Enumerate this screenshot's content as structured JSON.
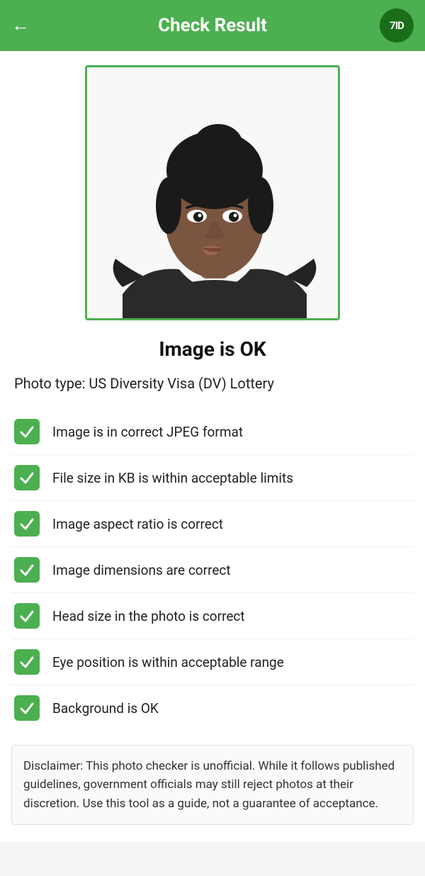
{
  "header": {
    "title": "Check Result",
    "back_arrow": "←",
    "logo_text": "7ID"
  },
  "photo": {
    "alt": "Passport photo of a young woman"
  },
  "status": {
    "heading": "Image is OK"
  },
  "photo_type_label": "Photo type: US Diversity Visa (DV) Lottery",
  "checks": [
    {
      "id": "jpeg",
      "label": "Image is in correct JPEG format",
      "passed": true
    },
    {
      "id": "filesize",
      "label": "File size in KB is within acceptable limits",
      "passed": true
    },
    {
      "id": "aspect",
      "label": "Image aspect ratio is correct",
      "passed": true
    },
    {
      "id": "dimensions",
      "label": "Image dimensions are correct",
      "passed": true
    },
    {
      "id": "headsize",
      "label": "Head size in the photo is correct",
      "passed": true
    },
    {
      "id": "eyepos",
      "label": "Eye position is within acceptable range",
      "passed": true
    },
    {
      "id": "background",
      "label": "Background is OK",
      "passed": true
    }
  ],
  "disclaimer": {
    "text": "Disclaimer: This photo checker is unofficial. While it follows published guidelines, government officials may still reject photos at their discretion. Use this tool as a guide, not a guarantee of acceptance."
  }
}
